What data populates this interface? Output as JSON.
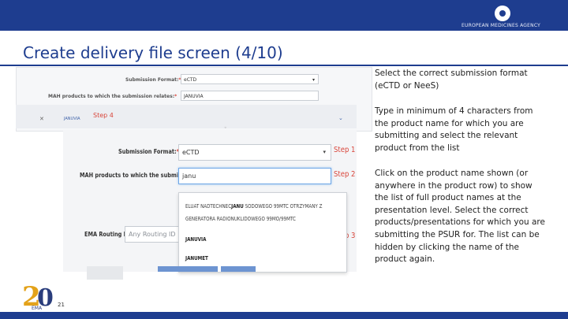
{
  "header": {
    "agency": "EUROPEAN MEDICINES AGENCY",
    "title": "Create delivery file screen (4/10)"
  },
  "bg_form": {
    "format_label": "Submission Format:",
    "format_value": "eCTD",
    "products_label": "MAH products to which the submission relates:",
    "products_value": "JANUVIA",
    "row_ref": "JANUVIA",
    "step_label": "Step 4"
  },
  "form": {
    "format_label": "Submission Format:",
    "format_value": "eCTD",
    "products_label": "MAH products to which the submission relates:",
    "products_value": "janu",
    "routing_label": "EMA Routing ID:",
    "routing_placeholder": "Any Routing ID",
    "required_mark": "*",
    "caret": "▾",
    "step1": "Step 1",
    "step2": "Step 2",
    "step3": "Step 3"
  },
  "dropdown": {
    "items": [
      {
        "pre": "ELUAT NADTECHNEC",
        "bold": "JANU",
        "post": " SODOWEGO 99MTC OTRZYMANY Z"
      },
      {
        "pre": "GENERATORA RADIONUKLIDOWEGO 99MO/99MTC",
        "bold": "",
        "post": ""
      },
      {
        "pre": "",
        "bold": "JANU",
        "post": "VIA"
      },
      {
        "pre": "",
        "bold": "JANU",
        "post": "MET"
      }
    ]
  },
  "notes": [
    "Select the correct submission format (eCTD or NeeS)",
    "Type in minimum of 4 characters from the product name for which you are submitting and select the relevant product from the list",
    "Click on the product name shown (or anywhere in the product row) to show the list of full product names at the presentation level. Select the correct products/presentations for which you are submitting the PSUR for.  The list can be hidden by clicking the name of the product again."
  ],
  "footer": {
    "anniv_digit_1": "2",
    "anniv_digit_2": "0",
    "anniv_label": "EMA",
    "page_number": "21"
  },
  "colors": {
    "brand_blue": "#1e3d8f",
    "step_red": "#d9463b",
    "anniversary_gold": "#e3a21a"
  }
}
